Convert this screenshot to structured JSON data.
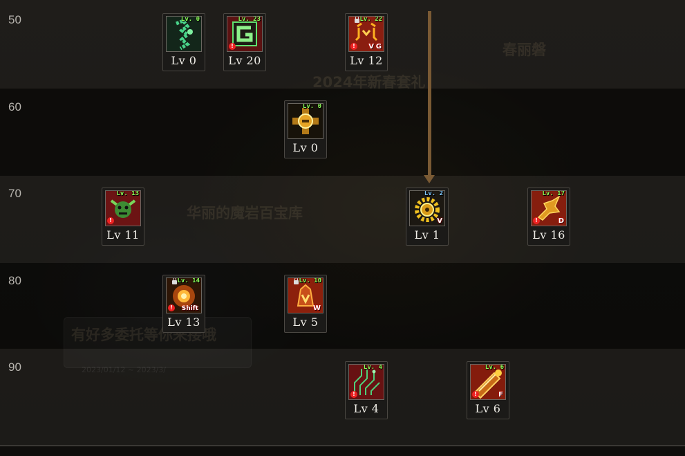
{
  "rows": [
    {
      "label": "50"
    },
    {
      "label": "60"
    },
    {
      "label": "70"
    },
    {
      "label": "80"
    },
    {
      "label": "90"
    }
  ],
  "background_text": {
    "t1": "2024年新春套礼",
    "t2": "华丽的魔岩百宝库",
    "t3": "有好多委托等你来接哦",
    "t4": "2023/01/12 ~ 2023/3/",
    "t5": "春丽磐"
  },
  "skills": [
    {
      "id": "s1",
      "mini": "Lv. 0",
      "level": "Lv 0",
      "locked": false,
      "warn": false,
      "hotkey": "",
      "theme": "green-chain"
    },
    {
      "id": "s2",
      "mini": "Lv. 23",
      "level": "Lv 20",
      "locked": false,
      "warn": true,
      "hotkey": "",
      "theme": "green-g"
    },
    {
      "id": "s3",
      "mini": "Lv. 22",
      "level": "Lv 12",
      "locked": true,
      "warn": true,
      "hotkey": "G",
      "hotkey_prefix": "V",
      "theme": "red-bracket"
    },
    {
      "id": "s4",
      "mini": "Lv. 0",
      "level": "Lv 0",
      "locked": false,
      "warn": false,
      "hotkey": "",
      "theme": "gold-cross"
    },
    {
      "id": "s5",
      "mini": "Lv. 13",
      "level": "Lv 11",
      "locked": false,
      "warn": true,
      "hotkey": "",
      "theme": "green-goblin"
    },
    {
      "id": "s6",
      "mini": "Lv. 2",
      "level": "Lv 1",
      "locked": false,
      "warn": false,
      "hotkey": "V",
      "theme": "gear",
      "mini_color": "blue"
    },
    {
      "id": "s7",
      "mini": "Lv. 17",
      "level": "Lv 16",
      "locked": false,
      "warn": true,
      "hotkey": "D",
      "theme": "red-dragon"
    },
    {
      "id": "s8",
      "mini": "Lv. 14",
      "level": "Lv 13",
      "locked": true,
      "warn": true,
      "hotkey": "Shift",
      "theme": "fire-burst"
    },
    {
      "id": "s9",
      "mini": "Lv. 10",
      "level": "Lv 5",
      "locked": true,
      "warn": false,
      "hotkey": "W",
      "theme": "red-mech"
    },
    {
      "id": "s10",
      "mini": "Lv. 4",
      "level": "Lv 4",
      "locked": false,
      "warn": true,
      "hotkey": "",
      "theme": "green-circuit"
    },
    {
      "id": "s11",
      "mini": "Lv. 6",
      "level": "Lv 6",
      "locked": false,
      "warn": true,
      "hotkey": "F",
      "theme": "fire-cannon"
    }
  ]
}
